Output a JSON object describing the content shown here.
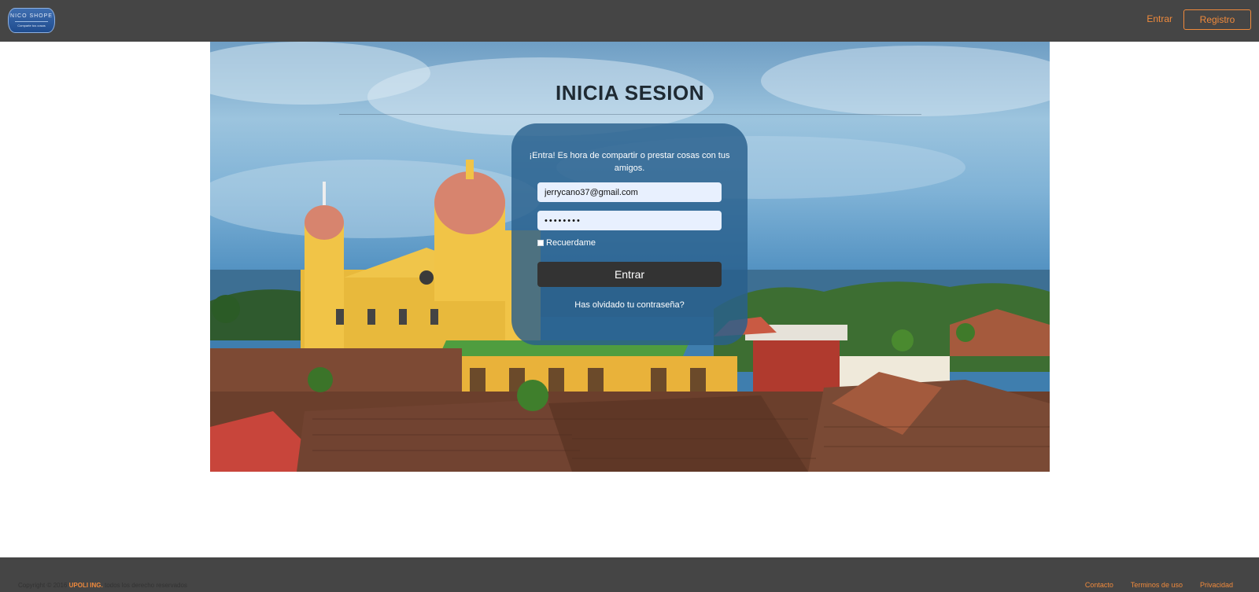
{
  "nav": {
    "logo": {
      "line1": "NICO SHOPE",
      "line2": "Comparte tus cosas"
    },
    "login_label": "Entrar",
    "register_label": "Registro"
  },
  "login": {
    "title": "INICIA SESION",
    "intro": "¡Entra! Es hora de compartir o prestar cosas con tus amigos.",
    "email_value": "jerrycano37@gmail.com",
    "password_value": "••••••••",
    "remember_label": "Recuerdame",
    "remember_checked": false,
    "submit_label": "Entrar",
    "forgot_label": "Has olvidado tu contraseña?"
  },
  "footer": {
    "copyright_prefix": "Copyright © 2016",
    "brand": "UPOLI ING.",
    "copyright_suffix": "todos los derecho reservados",
    "links": [
      "Contacto",
      "Terminos de uso",
      "Privacidad"
    ]
  },
  "colors": {
    "navbar_bg": "#454545",
    "accent": "#f08a3c",
    "card_bg": "#285f8c",
    "button_bg": "#333333"
  }
}
